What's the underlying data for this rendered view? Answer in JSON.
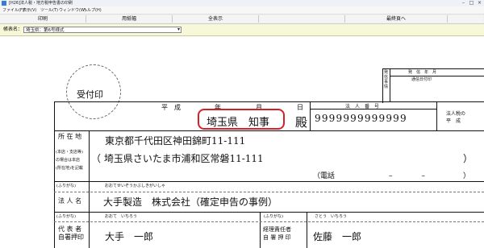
{
  "window": {
    "title": "[H26]法人税・地方税申告書の印刷",
    "buttons": [
      "–",
      "□",
      "×"
    ]
  },
  "menu": [
    "ファイル(F)",
    "表示(V)",
    "ツール(T)",
    "ウィンドウ(W)",
    "ヘルプ(H)"
  ],
  "toolbar": {
    "print": "印刷",
    "preview": "用紙幅",
    "show_all": "全表示",
    "last_page": "最終頁へ"
  },
  "form_select": {
    "label": "帳表名：",
    "value": "埼玉県：第6号様式"
  },
  "document": {
    "receipt_stamp": "受付印",
    "era": "平　成",
    "year": "年",
    "month": "月",
    "day": "日",
    "addressee": "埼玉県　知事",
    "honorific": "殿",
    "corp_number_label": "法　人　番　号",
    "corp_number": "9999999999999",
    "sub_label": "法人税の\n平　成",
    "right_box": {
      "col1": "発\n信\n事\n情",
      "header_a": "発　信　年　月",
      "header_b": "通信日付印"
    },
    "address_label": "所 在 地",
    "address_note": "(本店・支店等)\nの場合は本店\n(所在地)を記載",
    "address_line1": "東京都千代田区神田錦町11-111",
    "address_line2": "（ 埼玉県さいたま市浦和区常磐11-111",
    "address_close": "）",
    "phone_label": "（電話",
    "phone_sep": "–　　　　–",
    "phone_close": "）",
    "furigana_label": "(ふりがな)",
    "corp_name_kana": "おおてせいぞうかぶしきがいしゃ",
    "corp_name_label": "法 人 名",
    "corp_name": "大手製造　株式会社（確定申告の事例）",
    "rep_kana_label": "(ふりがな)",
    "rep_kana": "おおて　いちろう",
    "rep_label": "代 表 者\n自署押印",
    "rep_name": "大手　一郎",
    "acct_kana_label": "(ふりがな)",
    "acct_kana": "さとう　いちろう",
    "acct_label": "経理責任者\n自 署 押 印",
    "acct_name": "佐藤　一郎"
  }
}
